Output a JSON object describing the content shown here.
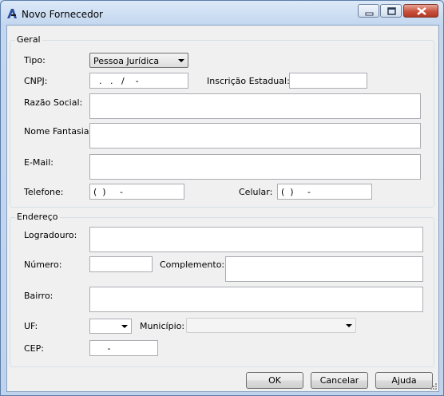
{
  "window": {
    "title": "Novo Fornecedor"
  },
  "geral": {
    "legend": "Geral",
    "tipo_label": "Tipo:",
    "tipo_value": "Pessoa Jurídica",
    "cnpj_label": "CNPJ:",
    "cnpj_value": "  .   .   /    -",
    "inscricao_label": "Inscrição Estadual:",
    "inscricao_value": "",
    "razao_label": "Razão Social:",
    "razao_value": "",
    "fantasia_label": "Nome Fantasia:",
    "fantasia_value": "",
    "email_label": "E-Mail:",
    "email_value": "",
    "telefone_label": "Telefone:",
    "telefone_value": "(  )     -",
    "celular_label": "Celular:",
    "celular_value": "(  )     -"
  },
  "endereco": {
    "legend": "Endereço",
    "logradouro_label": "Logradouro:",
    "logradouro_value": "",
    "numero_label": "Número:",
    "numero_value": "",
    "complemento_label": "Complemento:",
    "complemento_value": "",
    "bairro_label": "Bairro:",
    "bairro_value": "",
    "uf_label": "UF:",
    "uf_value": "",
    "municipio_label": "Município:",
    "municipio_value": "",
    "cep_label": "CEP:",
    "cep_value": "     -"
  },
  "buttons": {
    "ok": "OK",
    "cancelar": "Cancelar",
    "ajuda": "Ajuda"
  }
}
